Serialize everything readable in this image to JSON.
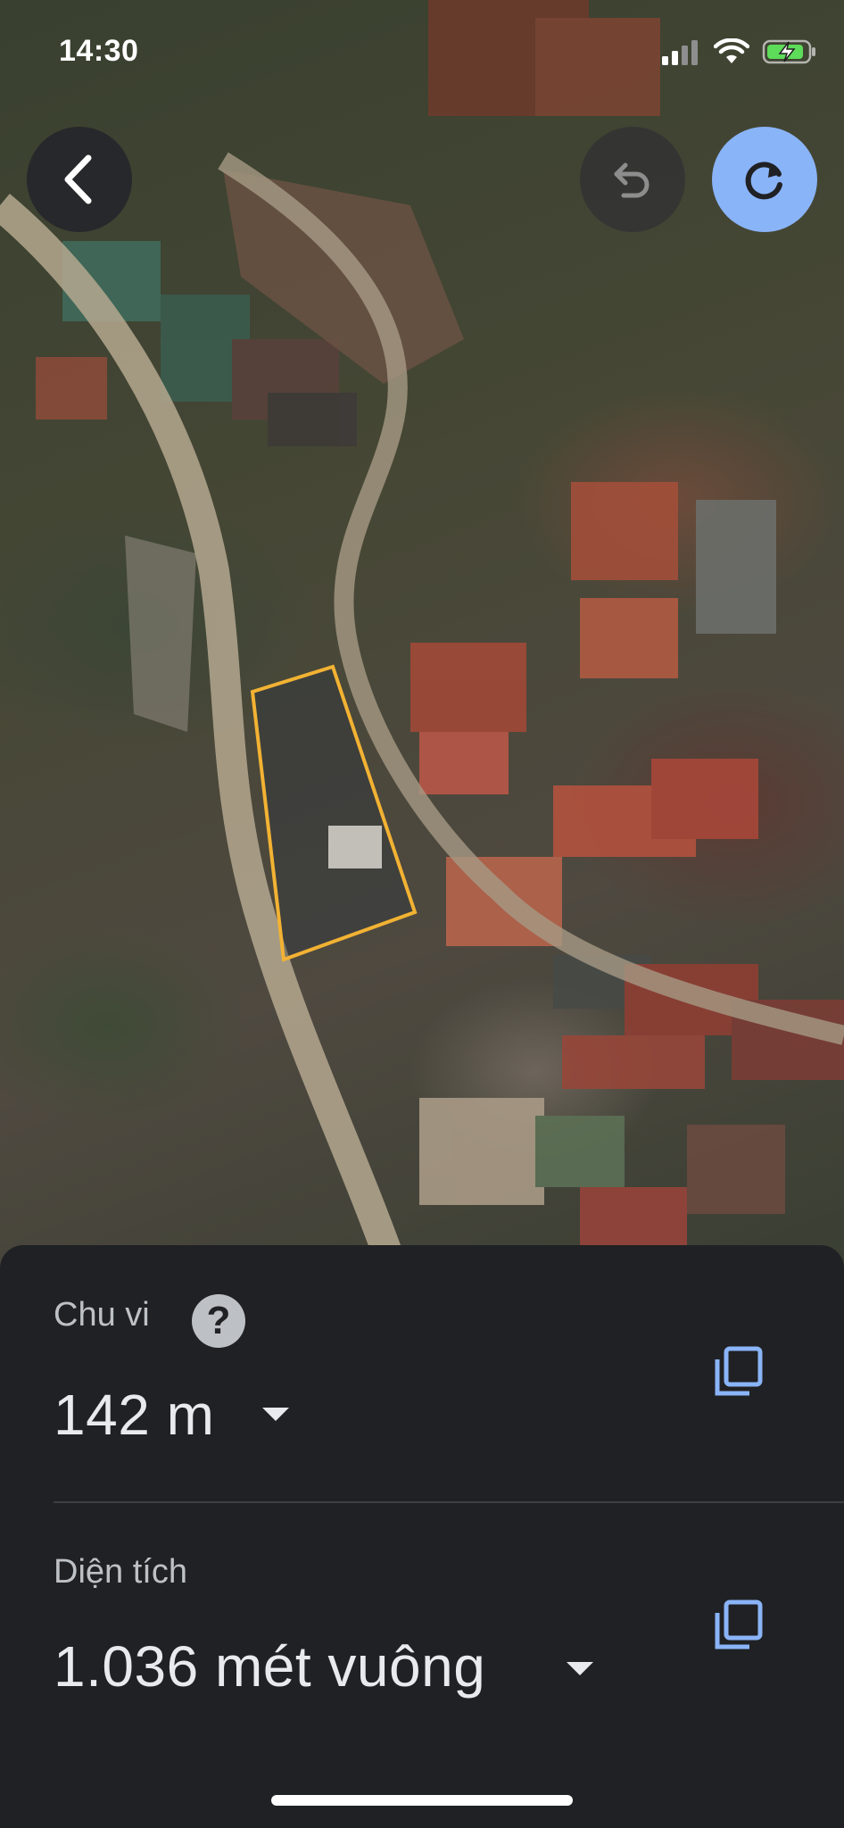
{
  "status_bar": {
    "time": "14:30"
  },
  "toolbar": {
    "back_icon": "back-arrow-icon",
    "undo_icon": "undo-icon",
    "redo_icon": "redo-icon",
    "redo_color": "#8ab4f8"
  },
  "map": {
    "type": "satellite",
    "polygon_color": "#f2b233"
  },
  "measurements": {
    "perimeter": {
      "label": "Chu vi",
      "value": "142 m",
      "help_symbol": "?",
      "copy_icon": "copy-icon"
    },
    "area": {
      "label": "Diện tích",
      "value": "1.036 mét vuông",
      "copy_icon": "copy-icon"
    }
  },
  "colors": {
    "sheet_background": "#202124",
    "accent": "#8ab4f8",
    "text_primary": "#e8eaed",
    "text_secondary": "#bdc1c6"
  }
}
